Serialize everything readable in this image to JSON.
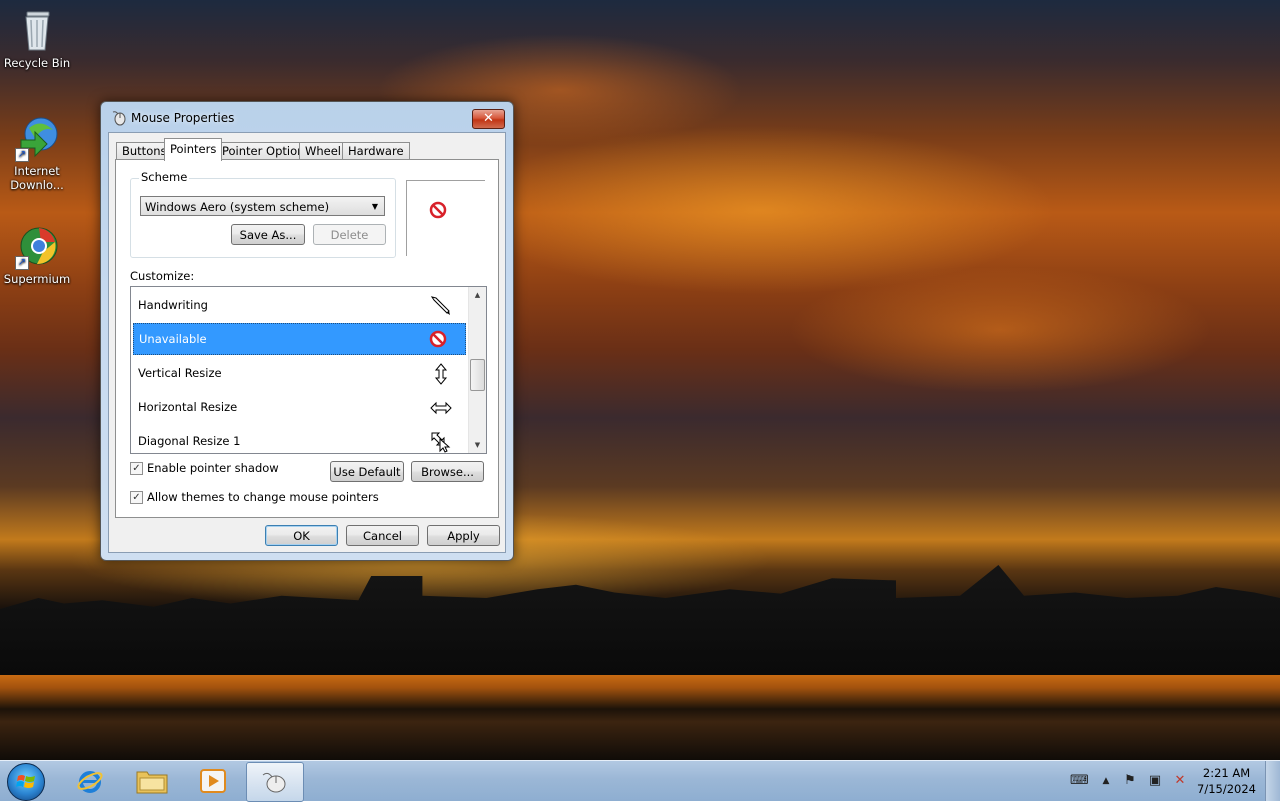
{
  "desktop": {
    "icons": [
      {
        "label": "Recycle Bin"
      },
      {
        "label": "Internet Downlo..."
      },
      {
        "label": "Supermium"
      }
    ]
  },
  "dialog": {
    "title": "Mouse Properties",
    "close_glyph": "✕",
    "tabs": [
      {
        "label": "Buttons"
      },
      {
        "label": "Pointers"
      },
      {
        "label": "Pointer Options"
      },
      {
        "label": "Wheel"
      },
      {
        "label": "Hardware"
      }
    ],
    "active_tab": "Pointers",
    "scheme": {
      "group_label": "Scheme",
      "selected": "Windows Aero (system scheme)",
      "save_as_label": "Save As...",
      "delete_label": "Delete"
    },
    "customize_label": "Customize:",
    "pointer_list": [
      {
        "label": "Handwriting",
        "icon": "pen-cursor-icon"
      },
      {
        "label": "Unavailable",
        "icon": "unavailable-cursor-icon",
        "selected": true
      },
      {
        "label": "Vertical Resize",
        "icon": "vertical-resize-cursor-icon"
      },
      {
        "label": "Horizontal Resize",
        "icon": "horizontal-resize-cursor-icon"
      },
      {
        "label": "Diagonal Resize 1",
        "icon": "diagonal-resize-cursor-icon"
      }
    ],
    "enable_shadow_label": "Enable pointer shadow",
    "enable_shadow_checked": true,
    "allow_themes_label": "Allow themes to change mouse pointers",
    "allow_themes_checked": true,
    "use_default_label": "Use Default",
    "browse_label": "Browse...",
    "ok_label": "OK",
    "cancel_label": "Cancel",
    "apply_label": "Apply"
  },
  "taskbar": {
    "pinned": [
      {
        "name": "internet-explorer"
      },
      {
        "name": "file-explorer"
      },
      {
        "name": "media-player"
      },
      {
        "name": "mouse-properties",
        "active": true
      }
    ],
    "clock_time": "2:21 AM",
    "clock_date": "7/15/2024"
  },
  "colors": {
    "selection": "#3399ff",
    "unavailable_red": "#d8212a",
    "taskbar": "#9bb7d6"
  }
}
